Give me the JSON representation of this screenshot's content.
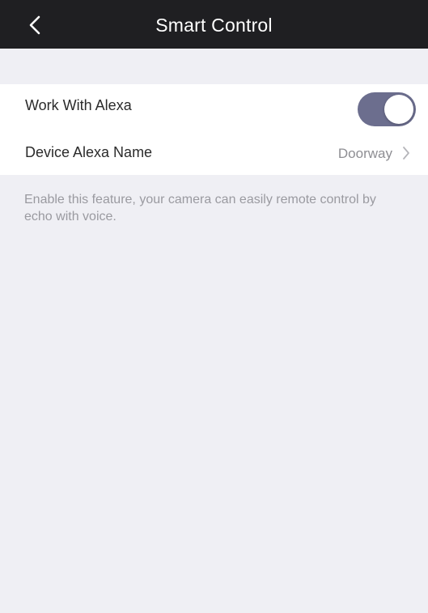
{
  "nav": {
    "title": "Smart Control",
    "back_icon": "chevron-left-icon"
  },
  "settings": {
    "work_with_alexa": {
      "label": "Work With Alexa",
      "enabled": true,
      "toggle_color": "#6c6e8e"
    },
    "device_alexa_name": {
      "label": "Device Alexa Name",
      "value": "Doorway",
      "icon": "chevron-right-icon"
    }
  },
  "note": "Enable this feature, your camera can easily remote control by echo with voice.",
  "colors": {
    "nav_background": "#1f1f22",
    "page_background": "#efeff4",
    "row_background": "#ffffff"
  }
}
